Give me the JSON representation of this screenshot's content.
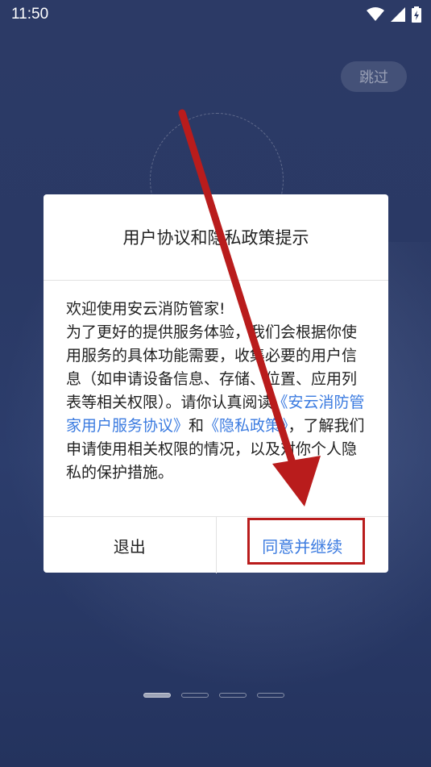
{
  "status_bar": {
    "time": "11:50",
    "icons": [
      "wifi-icon",
      "signal-icon",
      "battery-charging-icon"
    ]
  },
  "skip_button": {
    "label": "跳过"
  },
  "dialog": {
    "title": "用户协议和隐私政策提示",
    "body": {
      "line1": "欢迎使用安云消防管家!",
      "text_before_links": "为了更好的提供服务体验，我们会根据你使用服务的具体功能需要，收集必要的用户信息（如申请设备信息、存储、位置、应用列表等相关权限）。请你认真阅读",
      "link_service": "《安云消防管家用户服务协议》",
      "and": "和",
      "link_privacy": "《隐私政策》",
      "text_after_links": "，了解我们申请使用相关权限的情况，以及对你个人隐私的保护措施。"
    },
    "exit_label": "退出",
    "agree_label": "同意并继续"
  },
  "pager": {
    "count": 4,
    "active_index": 0
  },
  "colors": {
    "accent": "#3b7be0",
    "annotation": "#b91c1c",
    "background": "#2c3a66"
  }
}
